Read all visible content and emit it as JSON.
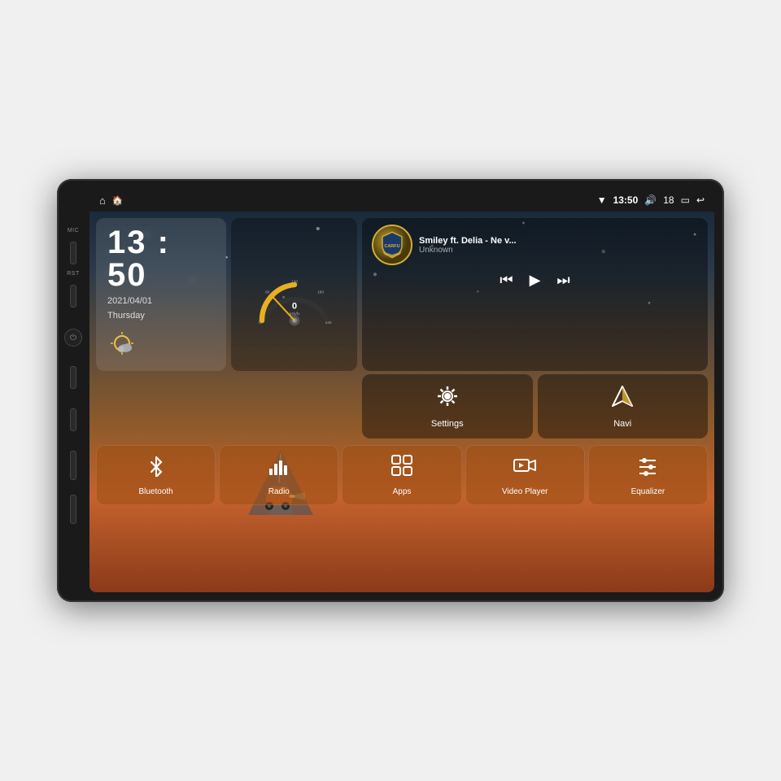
{
  "device": {
    "title": "Car Android Head Unit"
  },
  "statusBar": {
    "homeIcon": "⌂",
    "appIcon": "⊞",
    "wifiIcon": "▼",
    "time": "13:50",
    "volumIcon": "🔊",
    "volume": "18",
    "batteryIcon": "▭",
    "backIcon": "↩"
  },
  "sideButtons": {
    "micLabel": "MIC",
    "rstLabel": "RST"
  },
  "clockWidget": {
    "time": "13 : 50",
    "date": "2021/04/01",
    "dayOfWeek": "Thursday",
    "weatherIcon": "☁"
  },
  "musicWidget": {
    "albumText": "CARFU",
    "title": "Smiley ft. Delia - Ne v...",
    "artist": "Unknown",
    "prevIcon": "⏮",
    "playIcon": "▶",
    "nextIcon": "⏭"
  },
  "speedometer": {
    "speed": "0",
    "unit": "km/h"
  },
  "actionTiles": [
    {
      "id": "settings",
      "icon": "⚙",
      "label": "Settings"
    },
    {
      "id": "navi",
      "icon": "◬",
      "label": "Navi"
    }
  ],
  "bottomTiles": [
    {
      "id": "bluetooth",
      "icon": "bluetooth",
      "label": "Bluetooth"
    },
    {
      "id": "radio",
      "icon": "radio",
      "label": "Radio"
    },
    {
      "id": "apps",
      "icon": "apps",
      "label": "Apps"
    },
    {
      "id": "videoplayer",
      "icon": "video",
      "label": "Video Player"
    },
    {
      "id": "equalizer",
      "icon": "equalizer",
      "label": "Equalizer"
    }
  ],
  "colors": {
    "accent": "#d4af37",
    "tileBackground": "rgba(160,80,20,0.6)",
    "screenBg1": "#1a2a3a",
    "screenBg2": "#c4622d"
  }
}
